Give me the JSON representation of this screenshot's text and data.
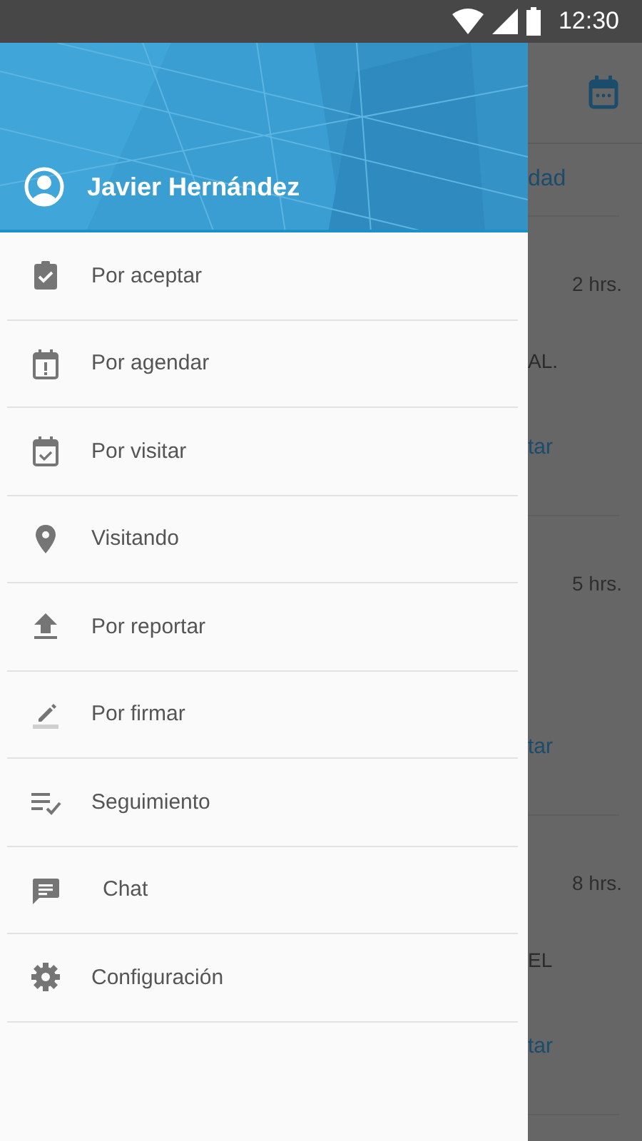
{
  "status_bar": {
    "time": "12:30"
  },
  "drawer": {
    "user_name": "Javier Hernández",
    "items": [
      {
        "label": "Por aceptar",
        "kind": "clipboard"
      },
      {
        "label": "Por agendar",
        "kind": "calendar-alert"
      },
      {
        "label": "Por visitar",
        "kind": "calendar-check"
      },
      {
        "label": "Visitando",
        "kind": "pin"
      },
      {
        "label": "Por reportar",
        "kind": "upload"
      },
      {
        "label": "Por firmar",
        "kind": "pencil"
      },
      {
        "label": "Seguimiento",
        "kind": "checklist"
      },
      {
        "label": "Chat",
        "kind": "chat"
      },
      {
        "label": "Configuración",
        "kind": "gear"
      }
    ]
  },
  "background": {
    "tab_label": "dad",
    "cards": [
      {
        "time": "2 hrs.",
        "line": "AL.",
        "action": "tar"
      },
      {
        "time": "5 hrs.",
        "action": "tar"
      },
      {
        "time": "8 hrs.",
        "line": "EL",
        "action": "tar"
      }
    ]
  }
}
